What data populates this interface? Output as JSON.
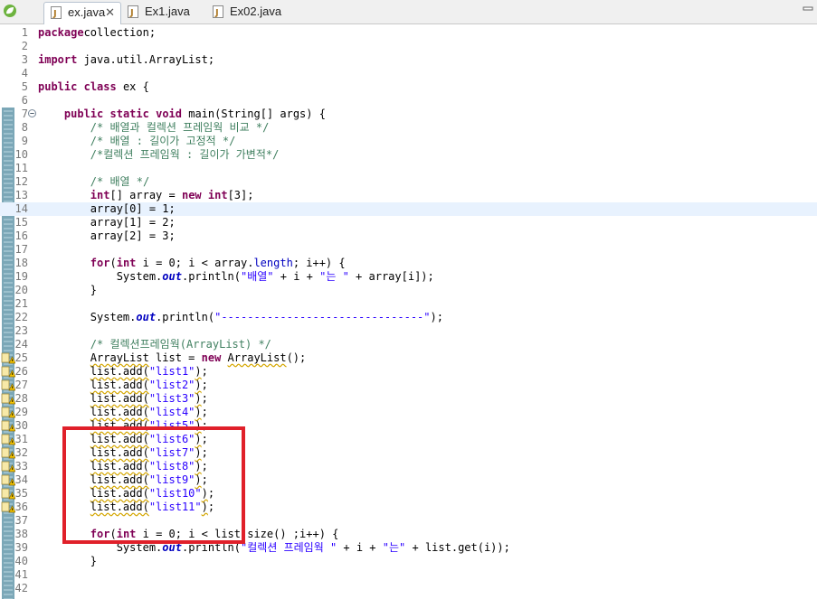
{
  "tabs": [
    {
      "label": "ex.java",
      "active": true,
      "close": "✕"
    },
    {
      "label": "Ex1.java",
      "active": false
    },
    {
      "label": "Ex02.java",
      "active": false
    }
  ],
  "colors": {
    "keyword": "#7f0055",
    "comment": "#3f7f5f",
    "string": "#2a00ff",
    "field": "#0000c0",
    "highlight_box": "#e0202a",
    "current_line": "#e8f2fe"
  },
  "icons": {
    "app": "spring-leaf-icon",
    "file": "java-file-icon",
    "warning": "warning-icon",
    "fold": "fold-minus-icon"
  },
  "editor": {
    "current_line": 14,
    "lines": [
      {
        "n": "1",
        "t": [
          [
            "kw",
            "package"
          ],
          [
            "",
            "collection;"
          ]
        ]
      },
      {
        "n": "2",
        "t": []
      },
      {
        "n": "3",
        "t": [
          [
            "kw",
            "import"
          ],
          [
            "",
            " java.util.ArrayList;"
          ]
        ]
      },
      {
        "n": "4",
        "t": []
      },
      {
        "n": "5",
        "t": [
          [
            "kw",
            "public"
          ],
          [
            "",
            " "
          ],
          [
            "kw",
            "class"
          ],
          [
            "",
            " ex {"
          ]
        ]
      },
      {
        "n": "6",
        "t": []
      },
      {
        "n": "7",
        "fold": true,
        "t": [
          [
            "",
            "    "
          ],
          [
            "kw",
            "public"
          ],
          [
            "",
            " "
          ],
          [
            "kw",
            "static"
          ],
          [
            "",
            " "
          ],
          [
            "kw",
            "void"
          ],
          [
            "",
            " main(String[] "
          ],
          [
            "",
            "args"
          ],
          [
            "",
            ") {"
          ]
        ]
      },
      {
        "n": "8",
        "t": [
          [
            "",
            "        "
          ],
          [
            "cm",
            "/* 배열과 컬렉션 프레임웍 비교 */"
          ]
        ]
      },
      {
        "n": "9",
        "t": [
          [
            "",
            "        "
          ],
          [
            "cm",
            "/* 배열 : 길이가 고정적 */"
          ]
        ]
      },
      {
        "n": "10",
        "t": [
          [
            "",
            "        "
          ],
          [
            "cm",
            "/*컬렉션 프레임웍 : 길이가 가변적*/"
          ]
        ]
      },
      {
        "n": "11",
        "t": []
      },
      {
        "n": "12",
        "t": [
          [
            "",
            "        "
          ],
          [
            "cm",
            "/* 배열 */"
          ]
        ]
      },
      {
        "n": "13",
        "t": [
          [
            "",
            "        "
          ],
          [
            "kw",
            "int"
          ],
          [
            "",
            "[] array = "
          ],
          [
            "kw",
            "new"
          ],
          [
            "",
            " "
          ],
          [
            "kw",
            "int"
          ],
          [
            "",
            "[3];"
          ]
        ]
      },
      {
        "n": "14",
        "t": [
          [
            "",
            "        array[0] = 1;"
          ]
        ]
      },
      {
        "n": "15",
        "t": [
          [
            "",
            "        array[1] = 2;"
          ]
        ]
      },
      {
        "n": "16",
        "t": [
          [
            "",
            "        array[2] = 3;"
          ]
        ]
      },
      {
        "n": "17",
        "t": []
      },
      {
        "n": "18",
        "t": [
          [
            "",
            "        "
          ],
          [
            "kw",
            "for"
          ],
          [
            "",
            "("
          ],
          [
            "kw",
            "int"
          ],
          [
            "",
            " i = 0; i < array."
          ],
          [
            "fd",
            "length"
          ],
          [
            "",
            "; i++) {"
          ]
        ]
      },
      {
        "n": "19",
        "t": [
          [
            "",
            "            System."
          ],
          [
            "sf",
            "out"
          ],
          [
            "",
            ".println("
          ],
          [
            "st",
            "\"배열\""
          ],
          [
            "",
            " + i + "
          ],
          [
            "st",
            "\"는 \""
          ],
          [
            "",
            " + array[i]);"
          ]
        ]
      },
      {
        "n": "20",
        "t": [
          [
            "",
            "        }"
          ]
        ]
      },
      {
        "n": "21",
        "t": []
      },
      {
        "n": "22",
        "t": [
          [
            "",
            "        System."
          ],
          [
            "sf",
            "out"
          ],
          [
            "",
            ".println("
          ],
          [
            "st",
            "\"-------------------------------\""
          ],
          [
            "",
            ");"
          ]
        ]
      },
      {
        "n": "23",
        "t": []
      },
      {
        "n": "24",
        "t": [
          [
            "",
            "        "
          ],
          [
            "cm",
            "/* 컬렉션프레임웍(ArrayList) */"
          ]
        ]
      },
      {
        "n": "25",
        "warn": true,
        "t": [
          [
            "",
            "        "
          ],
          [
            "raw",
            "ArrayList"
          ],
          [
            "",
            " list = "
          ],
          [
            "kw",
            "new"
          ],
          [
            "",
            " "
          ],
          [
            "raw",
            "ArrayList"
          ],
          [
            "",
            "();"
          ]
        ]
      },
      {
        "n": "26",
        "warn": true,
        "t": [
          [
            "",
            "        "
          ],
          [
            "raw",
            "list.add("
          ],
          [
            "st",
            "\"list1\""
          ],
          [
            "raw",
            ")"
          ],
          [
            "",
            ";"
          ]
        ]
      },
      {
        "n": "27",
        "warn": true,
        "t": [
          [
            "",
            "        "
          ],
          [
            "raw",
            "list.add("
          ],
          [
            "st",
            "\"list2\""
          ],
          [
            "raw",
            ")"
          ],
          [
            "",
            ";"
          ]
        ]
      },
      {
        "n": "28",
        "warn": true,
        "t": [
          [
            "",
            "        "
          ],
          [
            "raw",
            "list.add("
          ],
          [
            "st",
            "\"list3\""
          ],
          [
            "raw",
            ")"
          ],
          [
            "",
            ";"
          ]
        ]
      },
      {
        "n": "29",
        "warn": true,
        "t": [
          [
            "",
            "        "
          ],
          [
            "raw",
            "list.add("
          ],
          [
            "st",
            "\"list4\""
          ],
          [
            "raw",
            ")"
          ],
          [
            "",
            ";"
          ]
        ]
      },
      {
        "n": "30",
        "warn": true,
        "t": [
          [
            "",
            "        "
          ],
          [
            "raw",
            "list.add("
          ],
          [
            "st",
            "\"list5\""
          ],
          [
            "raw",
            ")"
          ],
          [
            "",
            ";"
          ]
        ]
      },
      {
        "n": "31",
        "warn": true,
        "t": [
          [
            "",
            "        "
          ],
          [
            "raw",
            "list.add("
          ],
          [
            "st",
            "\"list6\""
          ],
          [
            "raw",
            ")"
          ],
          [
            "",
            ";"
          ]
        ]
      },
      {
        "n": "32",
        "warn": true,
        "t": [
          [
            "",
            "        "
          ],
          [
            "raw",
            "list.add("
          ],
          [
            "st",
            "\"list7\""
          ],
          [
            "raw",
            ")"
          ],
          [
            "",
            ";"
          ]
        ]
      },
      {
        "n": "33",
        "warn": true,
        "t": [
          [
            "",
            "        "
          ],
          [
            "raw",
            "list.add("
          ],
          [
            "st",
            "\"list8\""
          ],
          [
            "raw",
            ")"
          ],
          [
            "",
            ";"
          ]
        ]
      },
      {
        "n": "34",
        "warn": true,
        "t": [
          [
            "",
            "        "
          ],
          [
            "raw",
            "list.add("
          ],
          [
            "st",
            "\"list9\""
          ],
          [
            "raw",
            ")"
          ],
          [
            "",
            ";"
          ]
        ]
      },
      {
        "n": "35",
        "warn": true,
        "t": [
          [
            "",
            "        "
          ],
          [
            "raw",
            "list.add("
          ],
          [
            "st",
            "\"list10\""
          ],
          [
            "raw",
            ")"
          ],
          [
            "",
            ";"
          ]
        ]
      },
      {
        "n": "36",
        "warn": true,
        "t": [
          [
            "",
            "        "
          ],
          [
            "raw",
            "list.add("
          ],
          [
            "st",
            "\"list11\""
          ],
          [
            "raw",
            ")"
          ],
          [
            "",
            ";"
          ]
        ]
      },
      {
        "n": "37",
        "t": []
      },
      {
        "n": "38",
        "t": [
          [
            "",
            "        "
          ],
          [
            "kw",
            "for"
          ],
          [
            "",
            "("
          ],
          [
            "kw",
            "int"
          ],
          [
            "",
            " i = 0; i < list.size() ;i++) {"
          ]
        ]
      },
      {
        "n": "39",
        "t": [
          [
            "",
            "            System."
          ],
          [
            "sf",
            "out"
          ],
          [
            "",
            ".println("
          ],
          [
            "st",
            "\"컬렉션 프레임웍 \""
          ],
          [
            "",
            " + i + "
          ],
          [
            "st",
            "\"는\""
          ],
          [
            "",
            " + list.get(i));"
          ]
        ]
      },
      {
        "n": "40",
        "t": [
          [
            "",
            "        }"
          ]
        ]
      },
      {
        "n": "41",
        "t": []
      },
      {
        "n": "42",
        "t": []
      }
    ]
  }
}
